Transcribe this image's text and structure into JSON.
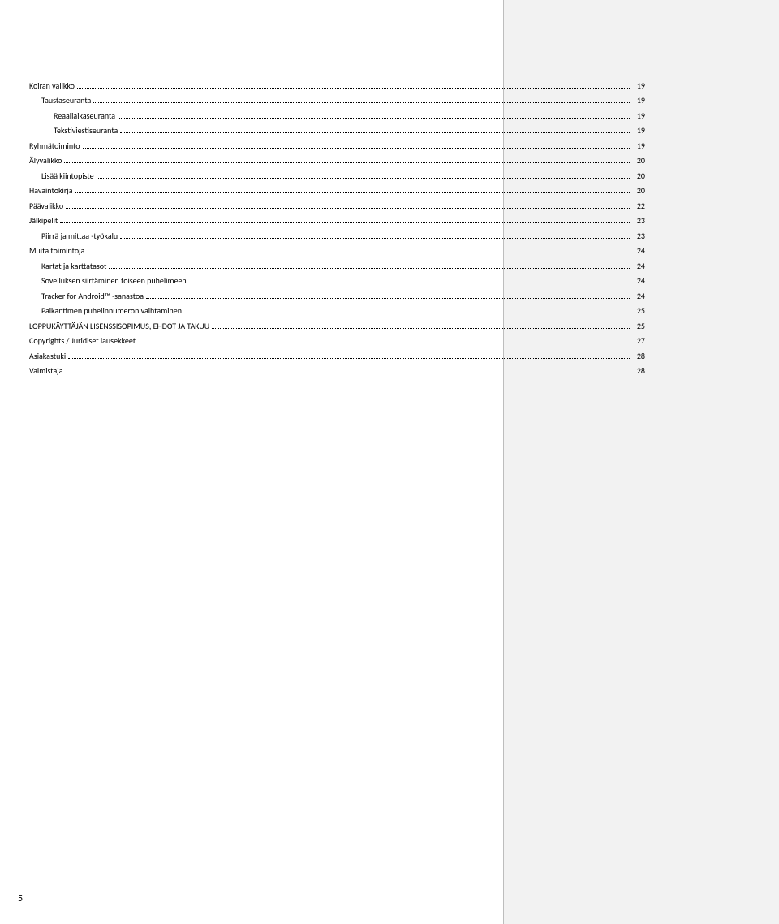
{
  "page_number": "5",
  "toc": [
    {
      "level": 0,
      "label": "Koiran valikko",
      "page": "19"
    },
    {
      "level": 1,
      "label": "Taustaseuranta",
      "page": "19"
    },
    {
      "level": 2,
      "label": "Reaaliaikaseuranta",
      "page": "19"
    },
    {
      "level": 2,
      "label": "Tekstiviestiseuranta",
      "page": "19"
    },
    {
      "level": 0,
      "label": "Ryhmätoiminto",
      "page": "19"
    },
    {
      "level": 0,
      "label": "Älyvalikko",
      "page": "20"
    },
    {
      "level": 1,
      "label": "Lisää kiintopiste",
      "page": "20"
    },
    {
      "level": 0,
      "label": "Havaintokirja",
      "page": "20"
    },
    {
      "level": 0,
      "label": "Päävalikko",
      "page": "22"
    },
    {
      "level": 0,
      "label": "Jälkipelit",
      "page": "23"
    },
    {
      "level": 1,
      "label": "Piirrä ja mittaa -työkalu",
      "page": "23"
    },
    {
      "level": 0,
      "label": "Muita toimintoja",
      "page": "24"
    },
    {
      "level": 1,
      "label": "Kartat ja karttatasot",
      "page": "24"
    },
    {
      "level": 1,
      "label": "Sovelluksen siirtäminen toiseen puhelimeen",
      "page": "24"
    },
    {
      "level": 1,
      "label": "Tracker for Android™ -sanastoa",
      "page": "24"
    },
    {
      "level": 1,
      "label": "Paikantimen puhelinnumeron vaihtaminen",
      "page": "25"
    },
    {
      "level": 0,
      "label": "LOPPUKÄYTTÄJÄN LISENSSISOPIMUS, EHDOT JA TAKUU",
      "page": "25"
    },
    {
      "level": 0,
      "label": "Copyrights / Juridiset lausekkeet",
      "page": "27"
    },
    {
      "level": 0,
      "label": "Asiakastuki",
      "page": "28"
    },
    {
      "level": 0,
      "label": "Valmistaja",
      "page": "28"
    }
  ]
}
